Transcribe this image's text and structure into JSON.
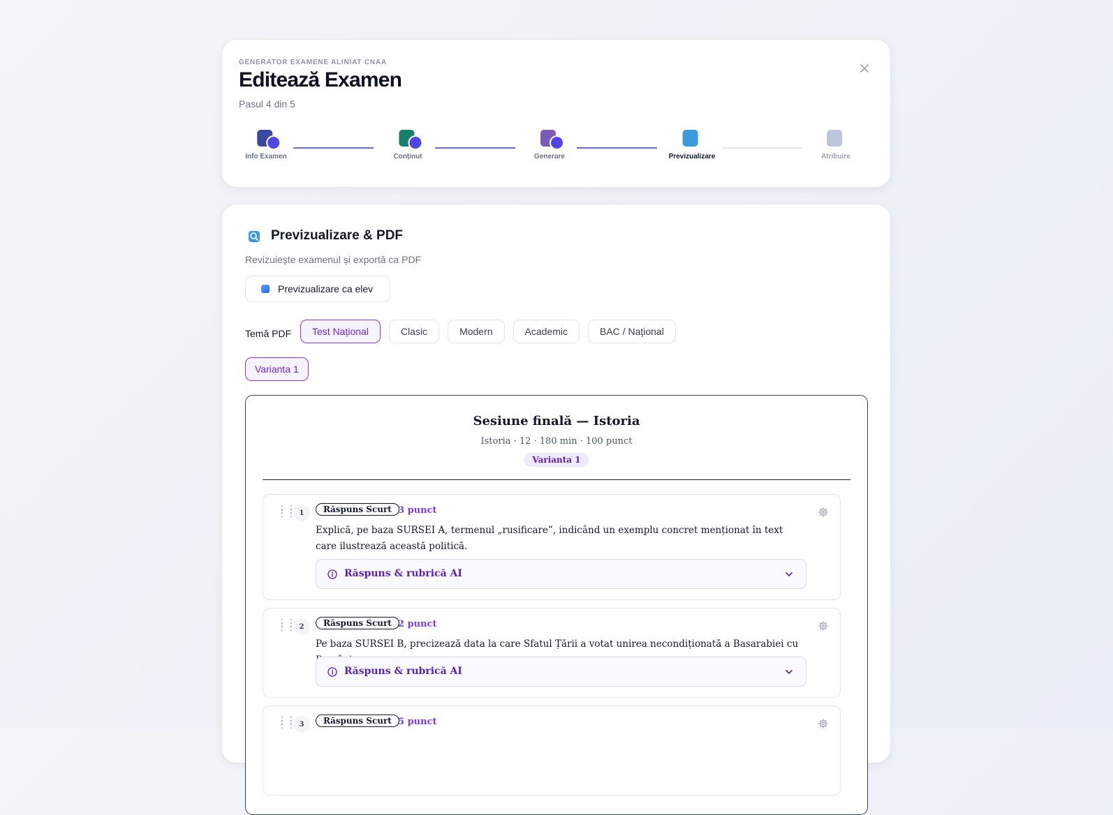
{
  "header": {
    "eyebrow": "GENERATOR EXAMENE ALINIAT CNAA",
    "title": "Editează Examen",
    "subtitle": "Pasul 4 din 5",
    "close_icon": "close-icon"
  },
  "steps": [
    {
      "label": "Info Examen",
      "state": "done",
      "icon": "clipboard-icon",
      "color": "#3b4a9e"
    },
    {
      "label": "Conținut",
      "state": "done",
      "icon": "books-icon",
      "color": "#16806b"
    },
    {
      "label": "Generare",
      "state": "done",
      "icon": "notepad-icon",
      "color": "#7b5ab5"
    },
    {
      "label": "Previzualizare",
      "state": "current",
      "icon": "magnifier-icon",
      "color": "#3b9ad9"
    },
    {
      "label": "Atribuire",
      "state": "future",
      "icon": "send-icon",
      "color": "#6a7fae"
    }
  ],
  "preview": {
    "title": "Previzualizare & PDF",
    "subtitle": "Revizuiește examenul și exportă ca PDF",
    "student_preview_button": "Previzualizare ca elev",
    "theme_label": "Temă PDF",
    "themes": [
      "Test Național",
      "Clasic",
      "Modern",
      "Academic",
      "BAC / Național"
    ],
    "active_theme": "Test Național",
    "variant": "Varianta 1"
  },
  "exam": {
    "title": "Sesiune finală — Istoria",
    "meta": "Istoria · 12 · 180 min · 100 punct",
    "variant_badge": "Varianta 1",
    "questions": [
      {
        "number": "1",
        "type": "Răspuns Scurt",
        "points": "3 punct",
        "text": "Explică, pe baza SURSEI A, termenul „rusificare”, indicând un exemplu concret menționat în text care ilustrează această politică.",
        "rubric_label": "Răspuns & rubrică AI"
      },
      {
        "number": "2",
        "type": "Răspuns Scurt",
        "points": "2 punct",
        "text": "Pe baza SURSEI B, precizează data la care Sfatul Țării a votat unirea necondiționată a Basarabiei cu România.",
        "rubric_label": "Răspuns & rubrică AI"
      },
      {
        "number": "3",
        "type": "Răspuns Scurt",
        "points": "5 punct",
        "text": "",
        "rubric_label": ""
      }
    ]
  }
}
